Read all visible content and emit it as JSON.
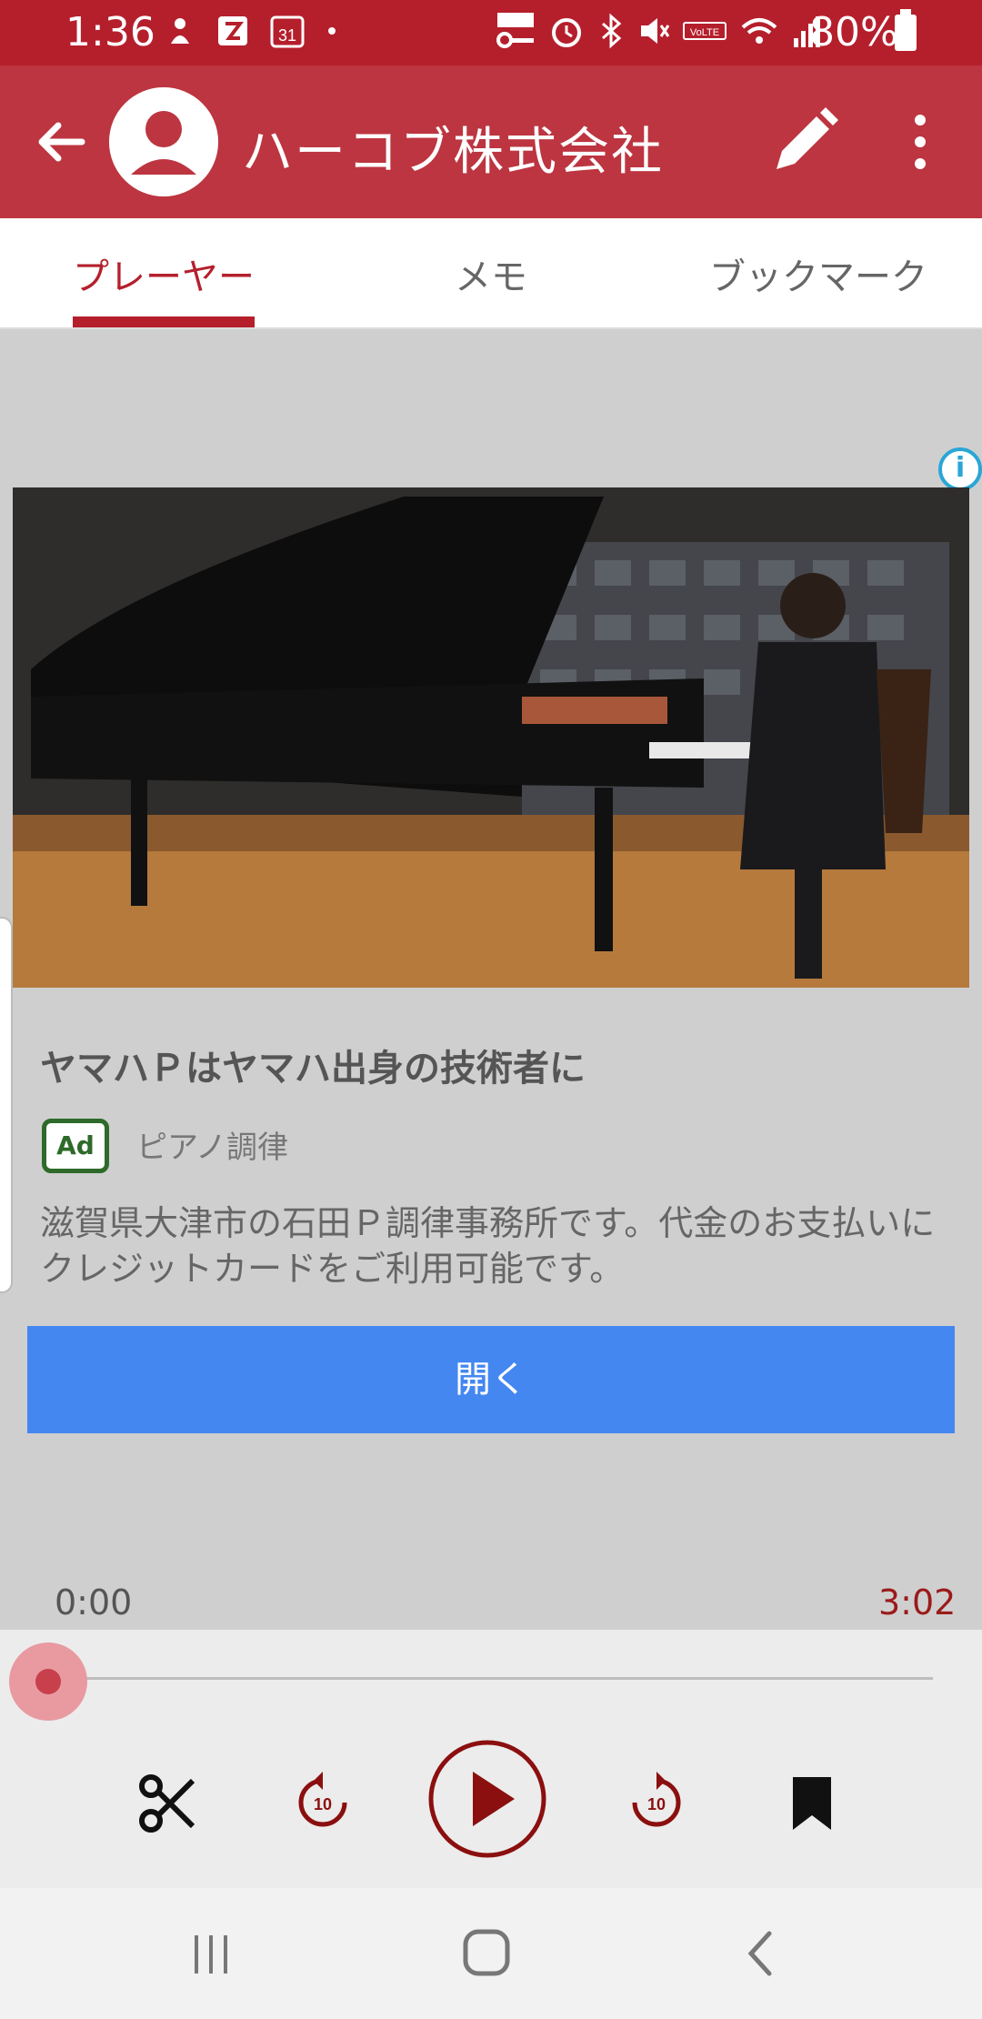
{
  "status_bar": {
    "time": "1:36",
    "battery": "80%",
    "calendar_day": "31",
    "left_icons": [
      "notification-icon",
      "app-icon",
      "calendar-icon",
      "dot-icon"
    ],
    "right_icons": [
      "ic-key-icon",
      "alarm-icon",
      "bluetooth-icon",
      "mute-icon",
      "volte-icon",
      "wifi-icon",
      "signal-icon"
    ]
  },
  "app_bar": {
    "title": "ハーコブ株式会社",
    "icons": [
      "back-arrow-icon",
      "avatar-icon",
      "pencil-icon",
      "more-vert-icon"
    ]
  },
  "tabs": [
    {
      "label": "プレーヤー",
      "active": true
    },
    {
      "label": "メモ",
      "active": false
    },
    {
      "label": "ブックマーク",
      "active": false
    }
  ],
  "ad": {
    "headline": "ヤマハＰはヤマハ出身の技術者に",
    "badge": "Ad",
    "category": "ピアノ調律",
    "description": "滋賀県大津市の石田Ｐ調律事務所です。代金のお支払いにクレジットカードをご利用可能です。",
    "cta": "開く",
    "info_icon": "info-icon",
    "image": "grand-piano-photo"
  },
  "player": {
    "elapsed": "0:00",
    "duration": "3:02",
    "progress": 0,
    "controls": [
      "scissors-icon",
      "replay-10-icon",
      "play-icon",
      "forward-10-icon",
      "bookmark-icon"
    ],
    "skip_seconds": "10"
  },
  "nav_bar": {
    "icons": [
      "recent-apps-icon",
      "home-icon",
      "back-icon"
    ]
  },
  "colors": {
    "status_bar": "#b51f2c",
    "app_bar": "#bc3540",
    "accent": "#b51f2c",
    "play_control": "#8b0f0f",
    "cta": "#4487f1"
  }
}
